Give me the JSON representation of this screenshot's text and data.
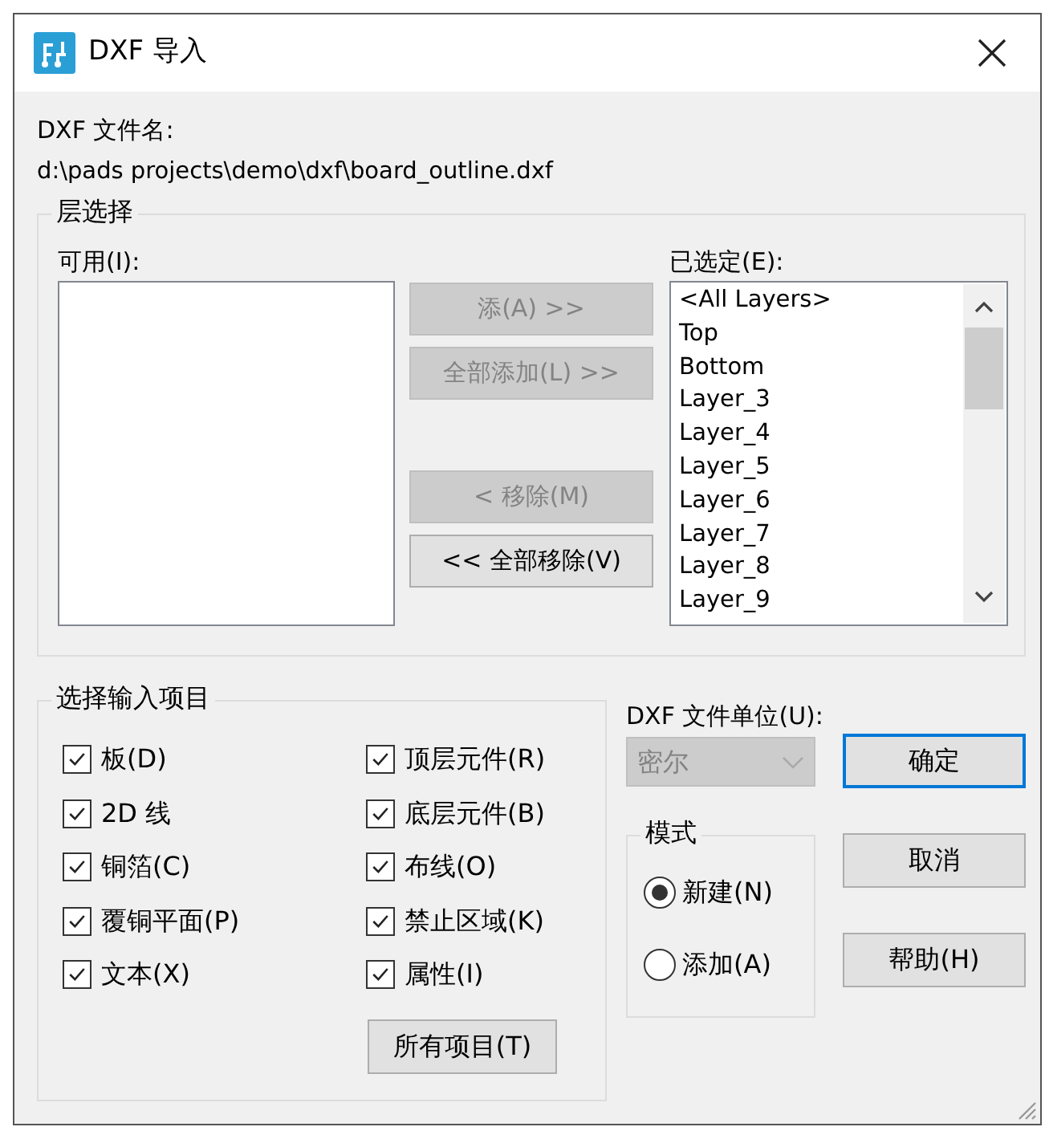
{
  "window": {
    "title": "DXF 导入"
  },
  "file_label": "DXF 文件名:",
  "file_path": "d:\\pads projects\\demo\\dxf\\board_outline.dxf",
  "layer_selection": {
    "title": "层选择",
    "available_label": "可用(I):",
    "selected_label": "已选定(E):",
    "transfer_buttons": [
      {
        "label": "添(A) >>",
        "disabled": true
      },
      {
        "label": "全部添加(L) >>",
        "disabled": true
      },
      {
        "label": "< 移除(M)",
        "disabled": true
      },
      {
        "label": "<< 全部移除(V)",
        "disabled": false
      }
    ],
    "selected_layers": [
      "<All Layers>",
      "Top",
      "Bottom",
      "Layer_3",
      "Layer_4",
      "Layer_5",
      "Layer_6",
      "Layer_7",
      "Layer_8",
      "Layer_9"
    ]
  },
  "import_items": {
    "title": "选择输入项目",
    "items": [
      {
        "label": "板(D)",
        "checked": true
      },
      {
        "label": "顶层元件(R)",
        "checked": true
      },
      {
        "label": "2D 线",
        "checked": true
      },
      {
        "label": "底层元件(B)",
        "checked": true
      },
      {
        "label": "铜箔(C)",
        "checked": true
      },
      {
        "label": "布线(O)",
        "checked": true
      },
      {
        "label": "覆铜平面(P)",
        "checked": true
      },
      {
        "label": "禁止区域(K)",
        "checked": true
      },
      {
        "label": "文本(X)",
        "checked": true
      },
      {
        "label": "属性(I)",
        "checked": true
      }
    ],
    "all_button": "所有项目(T)"
  },
  "units": {
    "label": "DXF 文件单位(U):",
    "value": "密尔",
    "disabled": true
  },
  "mode": {
    "title": "模式",
    "options": [
      {
        "label": "新建(N)",
        "selected": true
      },
      {
        "label": "添加(A)",
        "selected": false
      }
    ]
  },
  "actions": [
    {
      "label": "确定",
      "default": true
    },
    {
      "label": "取消",
      "default": false
    },
    {
      "label": "帮助(H)",
      "default": false
    }
  ]
}
